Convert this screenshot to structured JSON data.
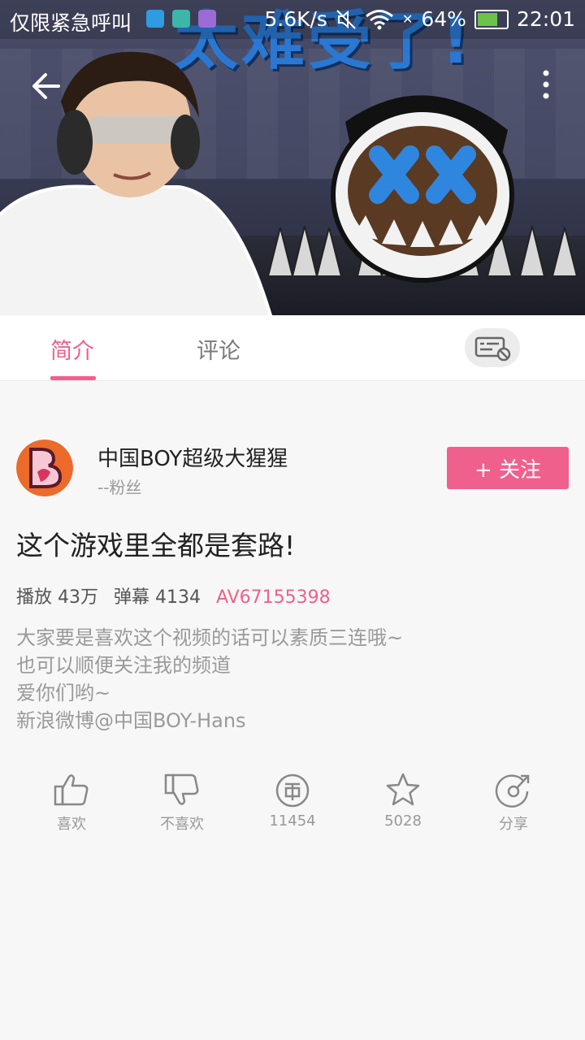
{
  "status_bar": {
    "carrier_text": "仅限紧急呼叫",
    "net_speed": "5.6K/s",
    "battery_percent": "64%",
    "time": "22:01"
  },
  "video": {
    "overlay_text": "太难受了!"
  },
  "tabs": [
    {
      "label": "简介",
      "active": true
    },
    {
      "label": "评论",
      "active": false
    }
  ],
  "uploader": {
    "name": "中国BOY超级大猩猩",
    "fans": "--粉丝",
    "follow_label": "+ 关注"
  },
  "video_info": {
    "title": "这个游戏里全都是套路!",
    "plays": "播放 43万",
    "danmaku": "弹幕 4134",
    "av_id": "AV67155398",
    "description": [
      "大家要是喜欢这个视频的话可以素质三连哦~",
      "也可以顺便关注我的频道",
      "爱你们哟~",
      "新浪微博@中国BOY-Hans"
    ]
  },
  "actions": [
    {
      "icon": "thumb-up-icon",
      "label": "喜欢"
    },
    {
      "icon": "thumb-down-icon",
      "label": "不喜欢"
    },
    {
      "icon": "coin-icon",
      "label": "11454"
    },
    {
      "icon": "star-icon",
      "label": "5028"
    },
    {
      "icon": "share-icon",
      "label": "分享"
    }
  ],
  "colors": {
    "accent": "#f0608c",
    "background": "#f7f7f7"
  }
}
